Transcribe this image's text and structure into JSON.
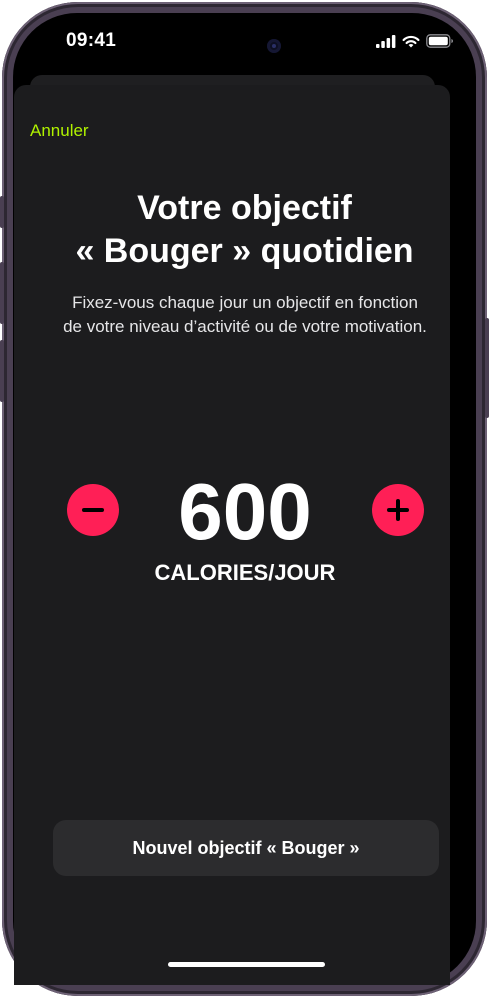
{
  "status_bar": {
    "time": "09:41"
  },
  "sheet": {
    "cancel_label": "Annuler",
    "title_line1": "Votre objectif",
    "title_line2": "« Bouger » quotidien",
    "subtitle": "Fixez-vous chaque jour un objectif en fonction de votre niveau d’activité ou de votre motivation."
  },
  "goal": {
    "value": "600",
    "unit": "CALORIES/JOUR"
  },
  "footer": {
    "button_label": "Nouvel objectif « Bouger »"
  },
  "colors": {
    "accent_green": "#b0f200",
    "stepper_red": "#ff1f56",
    "sheet_background": "#1c1c1e",
    "button_background": "#2c2c2e"
  },
  "icons": [
    "cellular-signal-icon",
    "wifi-icon",
    "battery-icon",
    "minus-icon",
    "plus-icon"
  ]
}
